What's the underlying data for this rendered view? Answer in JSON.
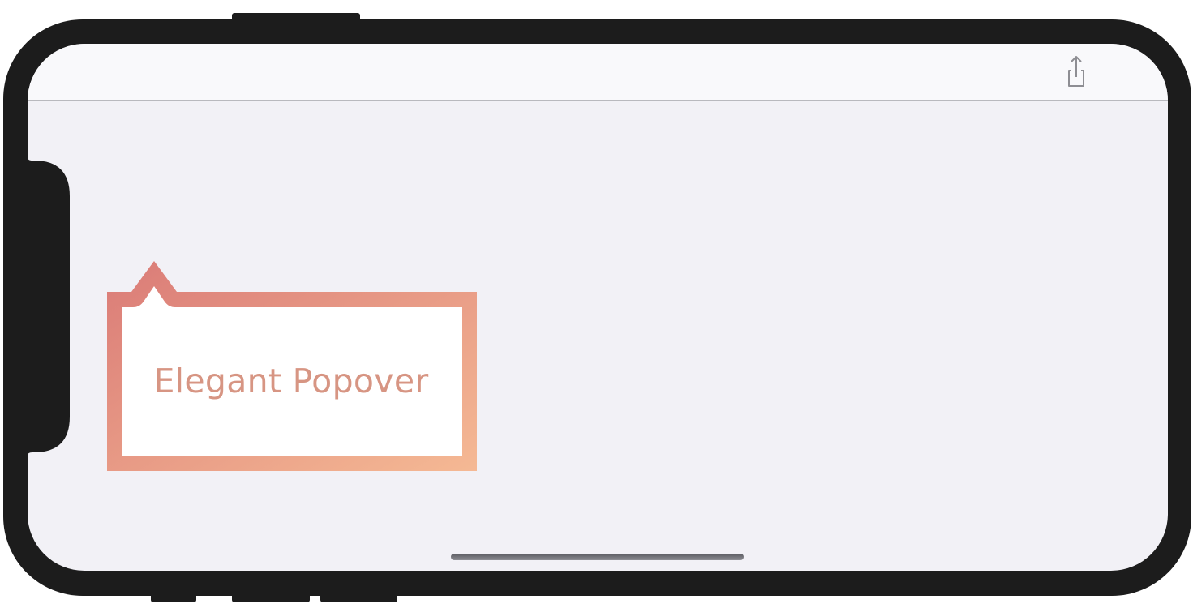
{
  "popover": {
    "label": "Elegant Popover",
    "gradient_start": "#da7b77",
    "gradient_end": "#f5b994",
    "text_color": "#d79583"
  },
  "navbar": {
    "actions": [
      {
        "icon": "share-icon"
      }
    ]
  },
  "colors": {
    "device_frame": "#1c1c1c",
    "screen_background": "#f2f1f6",
    "navbar_background": "#f9f9fb",
    "icon_tint": "#8e8e93"
  }
}
